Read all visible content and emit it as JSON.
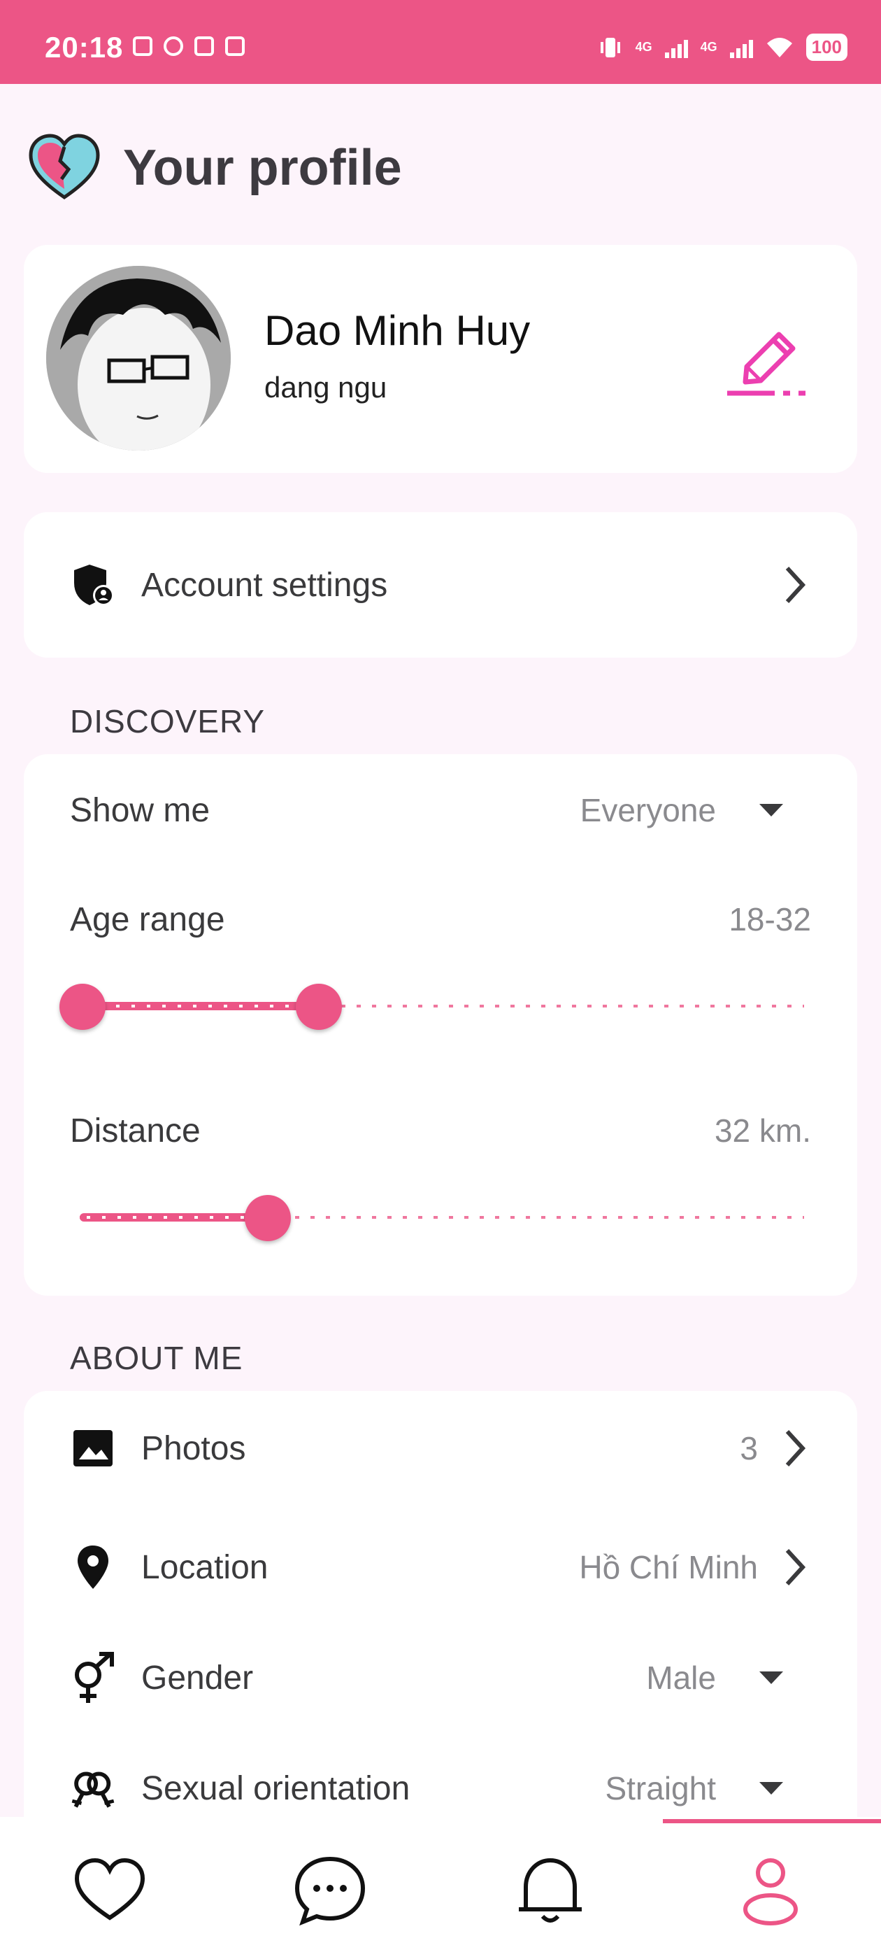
{
  "status_bar": {
    "time": "20:18",
    "battery": "100",
    "network_1": "4G",
    "network_2": "4G"
  },
  "header": {
    "title": "Your profile",
    "logo_icon": "heart-logo-icon"
  },
  "profile": {
    "name": "Dao Minh Huy",
    "status": "dang ngu",
    "edit_icon": "pencil-icon"
  },
  "account": {
    "label": "Account settings",
    "icon": "shield-user-icon"
  },
  "discovery": {
    "heading": "DISCOVERY",
    "show_me": {
      "label": "Show me",
      "value": "Everyone"
    },
    "age_range": {
      "label": "Age range",
      "value": "18-32",
      "min": 18,
      "max": 32,
      "slider_min_fraction": 0.0,
      "slider_max_fraction": 0.33
    },
    "distance": {
      "label": "Distance",
      "value": "32 km.",
      "slider_fraction": 0.26
    }
  },
  "about_me": {
    "heading": "ABOUT ME",
    "photos": {
      "label": "Photos",
      "value": "3",
      "icon": "image-icon"
    },
    "location": {
      "label": "Location",
      "value": "Hồ Chí Minh",
      "icon": "location-pin-icon"
    },
    "gender": {
      "label": "Gender",
      "value": "Male",
      "icon": "gender-icon"
    },
    "orientation": {
      "label": "Sexual orientation",
      "value": "Straight",
      "icon": "orientation-icon"
    }
  },
  "bottom_nav": {
    "items": [
      "heart-icon",
      "chat-icon",
      "bell-icon",
      "profile-icon"
    ],
    "active": "profile-icon"
  },
  "colors": {
    "accent": "#ec5586",
    "background": "#fdf4fb",
    "card": "#ffffff"
  }
}
